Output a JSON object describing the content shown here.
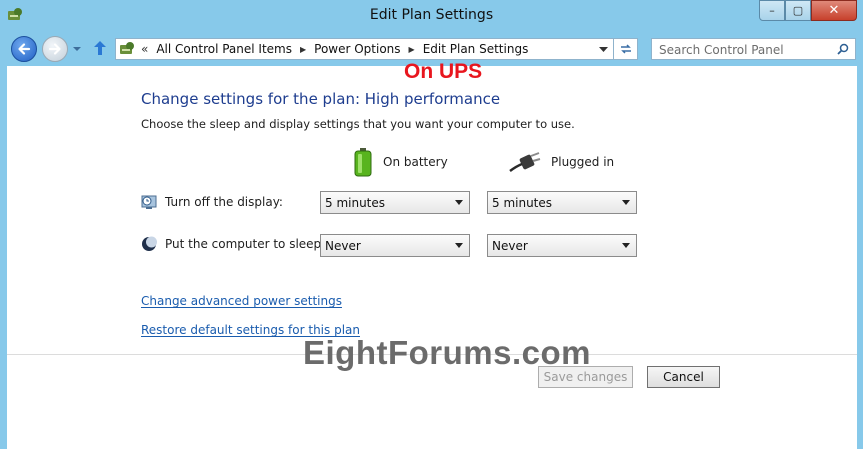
{
  "window": {
    "title": "Edit Plan Settings",
    "minimize_glyph": "–",
    "maximize_glyph": "▢",
    "close_glyph": "✕"
  },
  "nav": {
    "breadcrumb_lead": "«",
    "breadcrumbs": [
      "All Control Panel Items",
      "Power Options",
      "Edit Plan Settings"
    ],
    "breadcrumb_separator": "▶",
    "search_placeholder": "Search Control Panel"
  },
  "overlay": {
    "ups_label": "On UPS",
    "watermark": "EightForums.com"
  },
  "main": {
    "heading": "Change settings for the plan: High performance",
    "subtext": "Choose the sleep and display settings that you want your computer to use.",
    "columns": {
      "battery": "On battery",
      "plugged": "Plugged in"
    },
    "rows": [
      {
        "label": "Turn off the display:",
        "battery_value": "5 minutes",
        "plugged_value": "5 minutes"
      },
      {
        "label": "Put the computer to sleep:",
        "battery_value": "Never",
        "plugged_value": "Never"
      }
    ],
    "links": {
      "advanced": "Change advanced power settings",
      "restore": "Restore default settings for this plan"
    },
    "buttons": {
      "save": "Save changes",
      "cancel": "Cancel"
    }
  },
  "colors": {
    "chrome": "#87c9ea",
    "heading": "#1e3d8f",
    "link": "#1a5cae",
    "ups_label": "#e8161e",
    "close_button": "#c7402c"
  }
}
